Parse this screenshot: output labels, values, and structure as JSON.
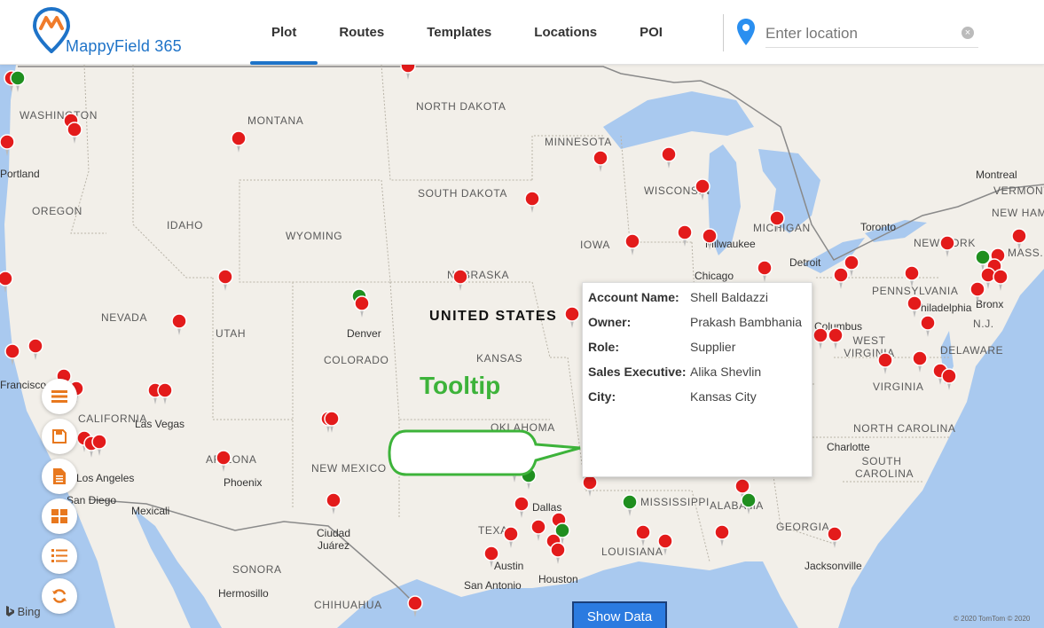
{
  "app": {
    "title": "MappyField 365",
    "accent": "#1e73c8",
    "logo_orange": "#f07b2a"
  },
  "nav": {
    "tabs": [
      {
        "label": "Plot",
        "active": true
      },
      {
        "label": "Routes",
        "active": false
      },
      {
        "label": "Templates",
        "active": false
      },
      {
        "label": "Locations",
        "active": false
      },
      {
        "label": "POI",
        "active": false
      }
    ]
  },
  "search": {
    "placeholder": "Enter location",
    "value": "",
    "pin_icon": "location-pin-icon",
    "clear_icon": "clear-icon"
  },
  "map": {
    "country_label": "UNITED STATES",
    "states": [
      "WASHINGTON",
      "MONTANA",
      "NORTH DAKOTA",
      "MINNESOTA",
      "OREGON",
      "IDAHO",
      "SOUTH DAKOTA",
      "WISCONSIN",
      "WYOMING",
      "IOWA",
      "NEBRASKA",
      "NEVADA",
      "UTAH",
      "COLORADO",
      "KANSAS",
      "CALIFORNIA",
      "ARIZONA",
      "NEW MEXICO",
      "OKLAHOMA",
      "TEXAS",
      "LOUISIANA",
      "MISSISSIPPI",
      "ALABAMA",
      "GEORGIA",
      "NORTH CAROLINA",
      "SOUTH CAROLINA",
      "WEST VIRGINIA",
      "VIRGINIA",
      "PENNSYLVANIA",
      "NEW YORK",
      "MICHIGAN",
      "VERMONT",
      "NEW HAMP",
      "MASS.",
      "DELAWARE",
      "N.J.",
      "SONORA",
      "CHIHUAHUA"
    ],
    "cities": [
      "Portland",
      "Francisco",
      "Las Vegas",
      "Los Angeles",
      "San Diego",
      "Mexicali",
      "Phoenix",
      "Denver",
      "Ciudad Juárez",
      "Hermosillo",
      "Austin",
      "San Antonio",
      "Houston",
      "Dallas",
      "Chicago",
      "Detroit",
      "Toronto",
      "Montreal",
      "Philadelphia",
      "Bronx",
      "Charlotte",
      "Jacksonville",
      "Milwaukee",
      "Columbus"
    ],
    "attribution_bing": "Bing",
    "copyright": "© 2020 TomTom © 2020"
  },
  "tooltip": {
    "callout_label": "Tooltip",
    "rows": [
      {
        "key": "Account Name:",
        "value": "Shell Baldazzi"
      },
      {
        "key": "Owner:",
        "value": "Prakash Bambhania"
      },
      {
        "key": "Role:",
        "value": "Supplier"
      },
      {
        "key": "Sales Executive:",
        "value": "Alika Shevlin"
      },
      {
        "key": "City:",
        "value": "Kansas City"
      }
    ]
  },
  "tools": [
    "list-icon",
    "save-icon",
    "document-icon",
    "grid-icon",
    "checklist-icon",
    "refresh-icon"
  ],
  "show_data_label": "Show Data",
  "pin_colors": {
    "red": "#e31b1b",
    "green": "#1f8f1f"
  }
}
